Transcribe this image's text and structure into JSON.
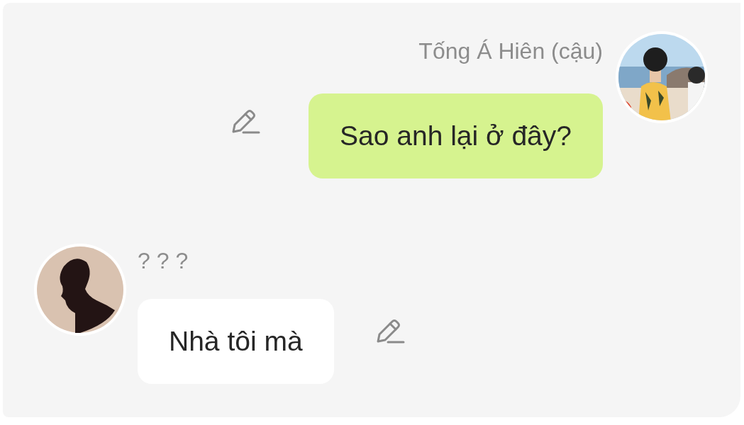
{
  "messages": [
    {
      "kind": "sent",
      "sender": "Tống Á Hiên (cậu)",
      "text": "Sao anh lại ở đây?"
    },
    {
      "kind": "received",
      "sender": "? ? ?",
      "avatar": {
        "kind": "silhouette"
      },
      "text": "Nhà tôi mà"
    }
  ]
}
